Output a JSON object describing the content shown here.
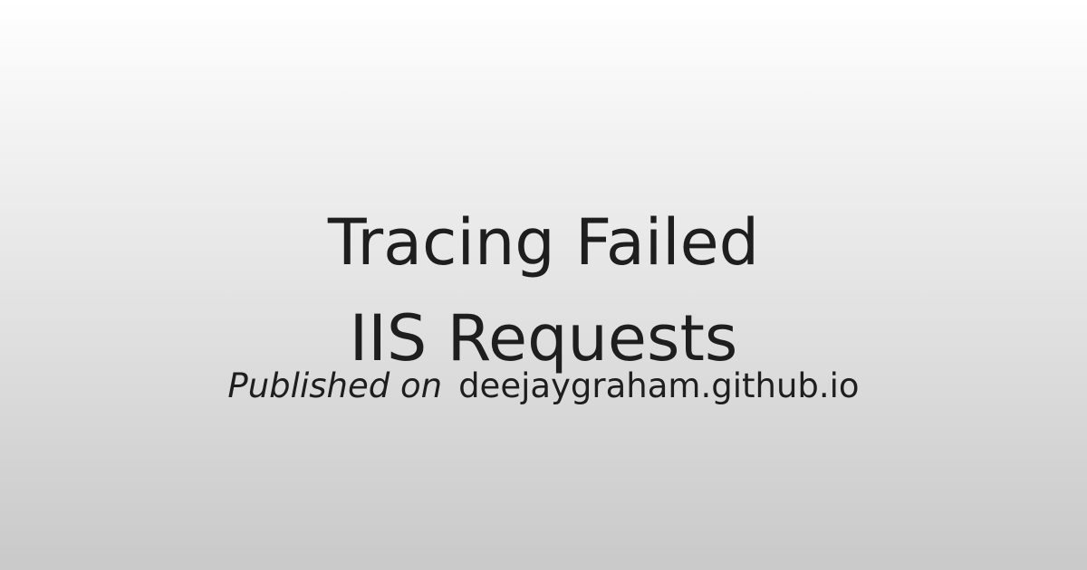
{
  "title": {
    "line1": "Tracing Failed",
    "line2": "IIS Requests"
  },
  "byline": {
    "prefix": "Published on",
    "site": "deejaygraham.github.io"
  },
  "colors": {
    "text": "#1e1e1e",
    "background_top": "#ffffff",
    "background_bottom": "#c9c9c9"
  }
}
